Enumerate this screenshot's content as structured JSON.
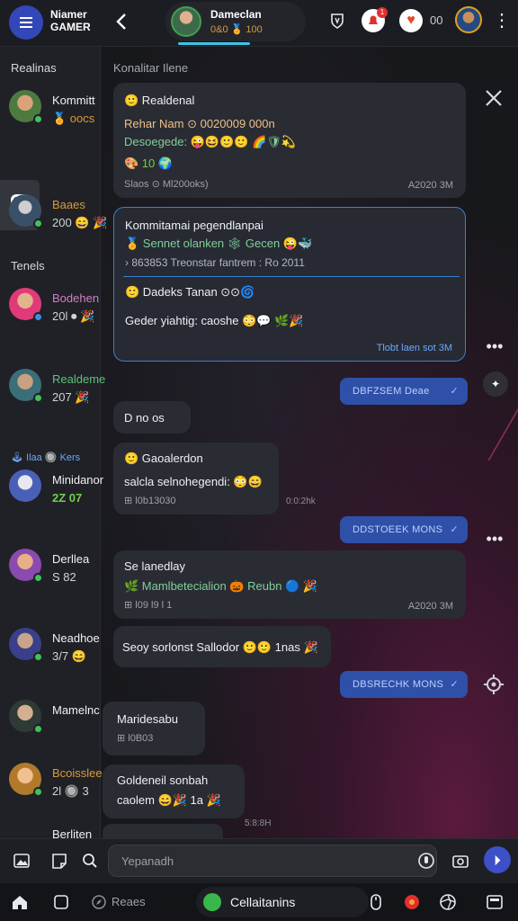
{
  "header": {
    "brand_line1": "Niamer",
    "brand_line2": "GAMER",
    "chat_name": "Dameclan",
    "chat_sub": "0&0 🏅 100",
    "count": "00"
  },
  "sidebar": {
    "section1": "Realinas",
    "section2": "Tenels",
    "items": [
      {
        "line1": "Kommitt",
        "line2": "🏅 oocs"
      },
      {
        "line1": "Baaes",
        "line2": "200 😄 🎉"
      },
      {
        "line1": "Bodehen",
        "line2": "20l ⏺ 🎉"
      },
      {
        "line1": "Realdeme",
        "line2": "207 🎉"
      },
      {
        "line1": "🕹 Ilaa  🔘 Kers",
        "line2": ""
      },
      {
        "line1": "Minidanor",
        "line2": "2Z 07"
      },
      {
        "line1": "Derllea",
        "line2": "S 82"
      },
      {
        "line1": "Neadhoe",
        "line2": "3/7 😄"
      },
      {
        "line1": "Mamelnc",
        "line2": ""
      },
      {
        "line1": "Bcoisslee",
        "line2": "2l 🔘 3"
      },
      {
        "line1": "Berliten",
        "line2": ""
      }
    ]
  },
  "chat": {
    "title": "Konalitar Ilene",
    "messages": [
      {
        "l1": "🙂 Realdenal",
        "l2": "Rehar Nam  ⊙ 0020009 000n",
        "l3": "Desoegede: 😜😆🙂🙂 🌈🛡💫",
        "l4": "🎨  10  🌍",
        "meta": "Slaos ⊙ Ml200oks)",
        "ts": "A2020 3M"
      },
      {
        "l1": "Kommitamai pegendlanpai",
        "l2": "🏅 Sennet olanken  🕸 Gecen 😜🐳",
        "l3": "›  863853 Treonstar fantrem : Ro 2011",
        "l4": "🙂 Dadeks Tanan  ⊙⊙🌀",
        "l5": "Geder yiahtig: caoshe 😳💬 🌿🎉",
        "l6": "Tlobt laen sot 3M"
      },
      {
        "text": "D no os"
      },
      {
        "l1": "🙂 Gaoalerdon",
        "l2": "salcla selnohegendi:  😳😄",
        "l3": "⊞ l0b13030",
        "ts": "0:0:2hk"
      },
      {
        "l1": "Se lanedlay",
        "l2": "🌿 Mamlbetecialion  🎃 Reubn  🔵 🎉",
        "l3": "⊞ l09 l9 l 1",
        "ts": "A2020 3M"
      },
      {
        "text": "Seoy sorlonst Sallodor  🙂🙂 1nas 🎉"
      },
      {
        "l1": "Maridesabu",
        "l2": "⊞ l0B03"
      },
      {
        "l1": "Goldeneil sonbah",
        "l2": "caolem 😄🎉 1a 🎉",
        "ts": "5:8:8H"
      }
    ],
    "outgoing": [
      "DBFZSEM Deae",
      "DDSTOEEK MONS",
      "DBSRECHK MONS"
    ]
  },
  "composer": {
    "placeholder": "Yepanadh"
  },
  "bottomnav": {
    "label1": "Reaes",
    "active_label": "Cellaitanins"
  }
}
